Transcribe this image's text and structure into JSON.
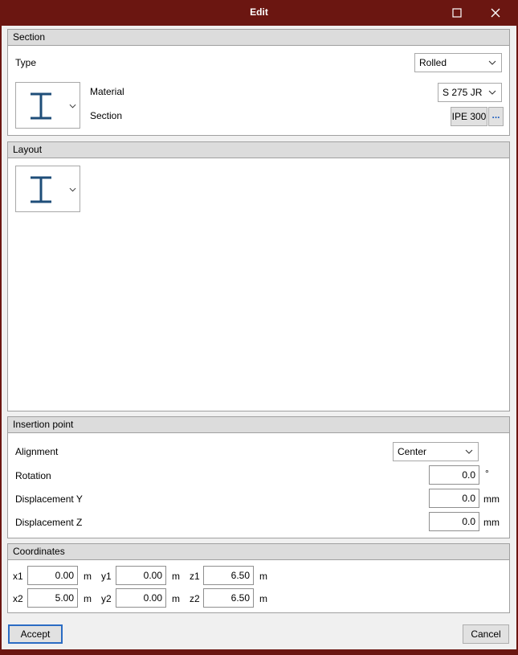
{
  "window": {
    "title": "Edit"
  },
  "section": {
    "header": "Section",
    "type_label": "Type",
    "type_value": "Rolled",
    "material_label": "Material",
    "material_value": "S 275 JR",
    "section_label": "Section",
    "section_value": "IPE 300",
    "browse_label": "...",
    "profile_icon": "i-beam-icon"
  },
  "layout": {
    "header": "Layout",
    "profile_icon": "i-beam-icon"
  },
  "insertion": {
    "header": "Insertion point",
    "alignment_label": "Alignment",
    "alignment_value": "Center",
    "rotation_label": "Rotation",
    "rotation_value": "0.0",
    "rotation_unit": "°",
    "dispY_label": "Displacement Y",
    "dispY_value": "0.0",
    "dispY_unit": "mm",
    "dispZ_label": "Displacement Z",
    "dispZ_value": "0.0",
    "dispZ_unit": "mm"
  },
  "coordinates": {
    "header": "Coordinates",
    "x1_label": "x1",
    "x1_value": "0.00",
    "y1_label": "y1",
    "y1_value": "0.00",
    "z1_label": "z1",
    "z1_value": "6.50",
    "x2_label": "x2",
    "x2_value": "5.00",
    "y2_label": "y2",
    "y2_value": "0.00",
    "z2_label": "z2",
    "z2_value": "6.50",
    "unit": "m"
  },
  "footer": {
    "accept_label": "Accept",
    "cancel_label": "Cancel"
  },
  "colors": {
    "titlebar": "#6b1611",
    "icon_blue": "#1f4e79",
    "panel_header": "#dcdcdc",
    "accept_border": "#2b6cc4"
  }
}
